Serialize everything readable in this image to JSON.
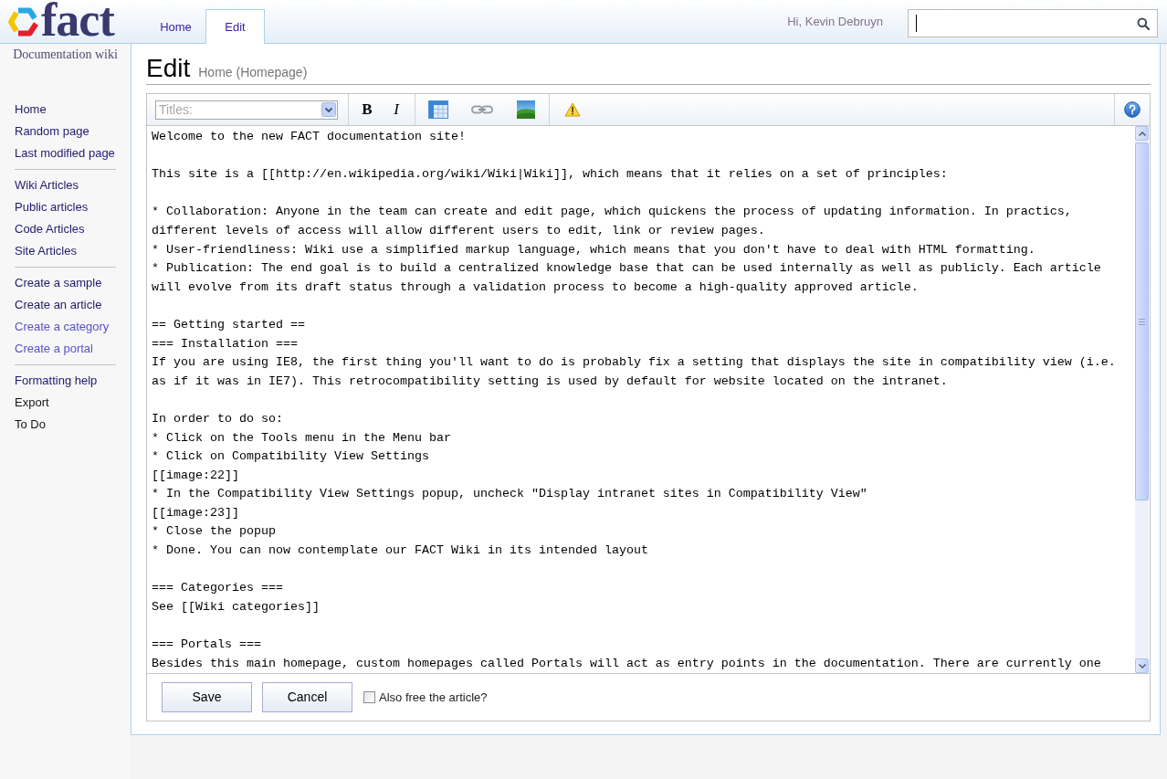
{
  "header": {
    "logo_text": "fact",
    "tabs": [
      {
        "label": "Home",
        "selected": false
      },
      {
        "label": "Edit",
        "selected": true
      }
    ],
    "greeting": "Hi, Kevin Debruyn"
  },
  "sidebar": {
    "tagline": "Documentation wiki",
    "groups": [
      [
        {
          "label": "Home",
          "kind": "link"
        },
        {
          "label": "Random page",
          "kind": "link"
        },
        {
          "label": "Last modified page",
          "kind": "link"
        }
      ],
      [
        {
          "label": "Wiki Articles",
          "kind": "link"
        },
        {
          "label": "Public articles",
          "kind": "link"
        },
        {
          "label": "Code Articles",
          "kind": "link"
        },
        {
          "label": "Site Articles",
          "kind": "link"
        }
      ],
      [
        {
          "label": "Create a sample",
          "kind": "link"
        },
        {
          "label": "Create an article",
          "kind": "link"
        },
        {
          "label": "Create a category",
          "kind": "visited"
        },
        {
          "label": "Create a portal",
          "kind": "visited"
        }
      ],
      [
        {
          "label": "Formatting help",
          "kind": "link"
        },
        {
          "label": "Export",
          "kind": "plain"
        },
        {
          "label": "To Do",
          "kind": "plain"
        }
      ]
    ]
  },
  "page": {
    "title": "Edit",
    "subtitle": "Home (Homepage)"
  },
  "editor": {
    "toolbar": {
      "select_placeholder": "Titles:",
      "groups": [
        [
          {
            "kind": "bold",
            "label": "B"
          },
          {
            "kind": "italic",
            "label": "I"
          }
        ],
        [
          {
            "kind": "table"
          },
          {
            "kind": "link"
          },
          {
            "kind": "image"
          }
        ],
        [
          {
            "kind": "warning"
          }
        ]
      ],
      "end_groups": [
        [
          {
            "kind": "help"
          }
        ]
      ]
    },
    "text_blocks": [
      [
        "Welcome to the new FACT documentation site!"
      ],
      [
        "This site is a [[http://en.wikipedia.org/wiki/Wiki|Wiki]], which means that it relies on a set of principles:"
      ],
      [
        "* Collaboration: Anyone in the team can create and edit page, which quickens the process of updating information. In practics, different levels of access will allow different users to edit, link or review pages.",
        "* User-friendliness: Wiki use a simplified markup language, which means that you don't have to deal with HTML formatting.",
        "* Publication: The end goal is to build a centralized knowledge base that can be used internally as well as publicly. Each article will evolve from its draft status through a validation process to become a high-quality approved article."
      ],
      [
        "== Getting started ==",
        "=== Installation ===",
        "If you are using IE8, the first thing you'll want to do is probably fix a setting that displays the site in compatibility view (i.e. as if it was in IE7). This retrocompatibility setting is used by default for website located on the intranet."
      ],
      [
        "In order to do so:",
        "* Click on the Tools menu in the Menu bar",
        "* Click on Compatibility View Settings",
        "[[image:22]]",
        "* In the Compatibility View Settings popup, uncheck \"Display intranet sites in Compatibility View\"",
        "[[image:23]]",
        "* Close the popup",
        "* Done. You can now contemplate our FACT Wiki in its intended layout"
      ],
      [
        "=== Categories ===",
        "See [[Wiki categories]]"
      ],
      [
        "=== Portals ===",
        "Besides this main homepage, custom homepages called Portals will act as entry points in the documentation. There are currently one"
      ]
    ],
    "buttons": [
      "Save",
      "Cancel"
    ],
    "free_option": {
      "label": "Also free the article?",
      "checked": false
    }
  }
}
